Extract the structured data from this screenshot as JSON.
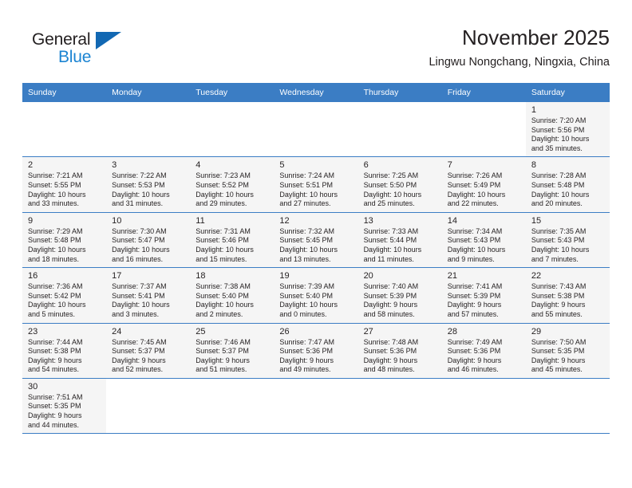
{
  "brand": {
    "name_part1": "General",
    "name_part2": "Blue",
    "triangle_color": "#1268b3",
    "blue_text_color": "#1b84d2"
  },
  "header": {
    "title": "November 2025",
    "subtitle": "Lingwu Nongchang, Ningxia, China"
  },
  "theme": {
    "header_bg": "#3b7dc4",
    "cell_fill": "#f5f5f5",
    "text": "#231f20"
  },
  "calendar": {
    "weekday_headers": [
      "Sunday",
      "Monday",
      "Tuesday",
      "Wednesday",
      "Thursday",
      "Friday",
      "Saturday"
    ],
    "weeks": [
      [
        {
          "day": "",
          "lines": []
        },
        {
          "day": "",
          "lines": []
        },
        {
          "day": "",
          "lines": []
        },
        {
          "day": "",
          "lines": []
        },
        {
          "day": "",
          "lines": []
        },
        {
          "day": "",
          "lines": []
        },
        {
          "day": "1",
          "lines": [
            "Sunrise: 7:20 AM",
            "Sunset: 5:56 PM",
            "Daylight: 10 hours",
            "and 35 minutes."
          ]
        }
      ],
      [
        {
          "day": "2",
          "lines": [
            "Sunrise: 7:21 AM",
            "Sunset: 5:55 PM",
            "Daylight: 10 hours",
            "and 33 minutes."
          ]
        },
        {
          "day": "3",
          "lines": [
            "Sunrise: 7:22 AM",
            "Sunset: 5:53 PM",
            "Daylight: 10 hours",
            "and 31 minutes."
          ]
        },
        {
          "day": "4",
          "lines": [
            "Sunrise: 7:23 AM",
            "Sunset: 5:52 PM",
            "Daylight: 10 hours",
            "and 29 minutes."
          ]
        },
        {
          "day": "5",
          "lines": [
            "Sunrise: 7:24 AM",
            "Sunset: 5:51 PM",
            "Daylight: 10 hours",
            "and 27 minutes."
          ]
        },
        {
          "day": "6",
          "lines": [
            "Sunrise: 7:25 AM",
            "Sunset: 5:50 PM",
            "Daylight: 10 hours",
            "and 25 minutes."
          ]
        },
        {
          "day": "7",
          "lines": [
            "Sunrise: 7:26 AM",
            "Sunset: 5:49 PM",
            "Daylight: 10 hours",
            "and 22 minutes."
          ]
        },
        {
          "day": "8",
          "lines": [
            "Sunrise: 7:28 AM",
            "Sunset: 5:48 PM",
            "Daylight: 10 hours",
            "and 20 minutes."
          ]
        }
      ],
      [
        {
          "day": "9",
          "lines": [
            "Sunrise: 7:29 AM",
            "Sunset: 5:48 PM",
            "Daylight: 10 hours",
            "and 18 minutes."
          ]
        },
        {
          "day": "10",
          "lines": [
            "Sunrise: 7:30 AM",
            "Sunset: 5:47 PM",
            "Daylight: 10 hours",
            "and 16 minutes."
          ]
        },
        {
          "day": "11",
          "lines": [
            "Sunrise: 7:31 AM",
            "Sunset: 5:46 PM",
            "Daylight: 10 hours",
            "and 15 minutes."
          ]
        },
        {
          "day": "12",
          "lines": [
            "Sunrise: 7:32 AM",
            "Sunset: 5:45 PM",
            "Daylight: 10 hours",
            "and 13 minutes."
          ]
        },
        {
          "day": "13",
          "lines": [
            "Sunrise: 7:33 AM",
            "Sunset: 5:44 PM",
            "Daylight: 10 hours",
            "and 11 minutes."
          ]
        },
        {
          "day": "14",
          "lines": [
            "Sunrise: 7:34 AM",
            "Sunset: 5:43 PM",
            "Daylight: 10 hours",
            "and 9 minutes."
          ]
        },
        {
          "day": "15",
          "lines": [
            "Sunrise: 7:35 AM",
            "Sunset: 5:43 PM",
            "Daylight: 10 hours",
            "and 7 minutes."
          ]
        }
      ],
      [
        {
          "day": "16",
          "lines": [
            "Sunrise: 7:36 AM",
            "Sunset: 5:42 PM",
            "Daylight: 10 hours",
            "and 5 minutes."
          ]
        },
        {
          "day": "17",
          "lines": [
            "Sunrise: 7:37 AM",
            "Sunset: 5:41 PM",
            "Daylight: 10 hours",
            "and 3 minutes."
          ]
        },
        {
          "day": "18",
          "lines": [
            "Sunrise: 7:38 AM",
            "Sunset: 5:40 PM",
            "Daylight: 10 hours",
            "and 2 minutes."
          ]
        },
        {
          "day": "19",
          "lines": [
            "Sunrise: 7:39 AM",
            "Sunset: 5:40 PM",
            "Daylight: 10 hours",
            "and 0 minutes."
          ]
        },
        {
          "day": "20",
          "lines": [
            "Sunrise: 7:40 AM",
            "Sunset: 5:39 PM",
            "Daylight: 9 hours",
            "and 58 minutes."
          ]
        },
        {
          "day": "21",
          "lines": [
            "Sunrise: 7:41 AM",
            "Sunset: 5:39 PM",
            "Daylight: 9 hours",
            "and 57 minutes."
          ]
        },
        {
          "day": "22",
          "lines": [
            "Sunrise: 7:43 AM",
            "Sunset: 5:38 PM",
            "Daylight: 9 hours",
            "and 55 minutes."
          ]
        }
      ],
      [
        {
          "day": "23",
          "lines": [
            "Sunrise: 7:44 AM",
            "Sunset: 5:38 PM",
            "Daylight: 9 hours",
            "and 54 minutes."
          ]
        },
        {
          "day": "24",
          "lines": [
            "Sunrise: 7:45 AM",
            "Sunset: 5:37 PM",
            "Daylight: 9 hours",
            "and 52 minutes."
          ]
        },
        {
          "day": "25",
          "lines": [
            "Sunrise: 7:46 AM",
            "Sunset: 5:37 PM",
            "Daylight: 9 hours",
            "and 51 minutes."
          ]
        },
        {
          "day": "26",
          "lines": [
            "Sunrise: 7:47 AM",
            "Sunset: 5:36 PM",
            "Daylight: 9 hours",
            "and 49 minutes."
          ]
        },
        {
          "day": "27",
          "lines": [
            "Sunrise: 7:48 AM",
            "Sunset: 5:36 PM",
            "Daylight: 9 hours",
            "and 48 minutes."
          ]
        },
        {
          "day": "28",
          "lines": [
            "Sunrise: 7:49 AM",
            "Sunset: 5:36 PM",
            "Daylight: 9 hours",
            "and 46 minutes."
          ]
        },
        {
          "day": "29",
          "lines": [
            "Sunrise: 7:50 AM",
            "Sunset: 5:35 PM",
            "Daylight: 9 hours",
            "and 45 minutes."
          ]
        }
      ],
      [
        {
          "day": "30",
          "lines": [
            "Sunrise: 7:51 AM",
            "Sunset: 5:35 PM",
            "Daylight: 9 hours",
            "and 44 minutes."
          ]
        },
        {
          "day": "",
          "lines": []
        },
        {
          "day": "",
          "lines": []
        },
        {
          "day": "",
          "lines": []
        },
        {
          "day": "",
          "lines": []
        },
        {
          "day": "",
          "lines": []
        },
        {
          "day": "",
          "lines": []
        }
      ]
    ]
  }
}
